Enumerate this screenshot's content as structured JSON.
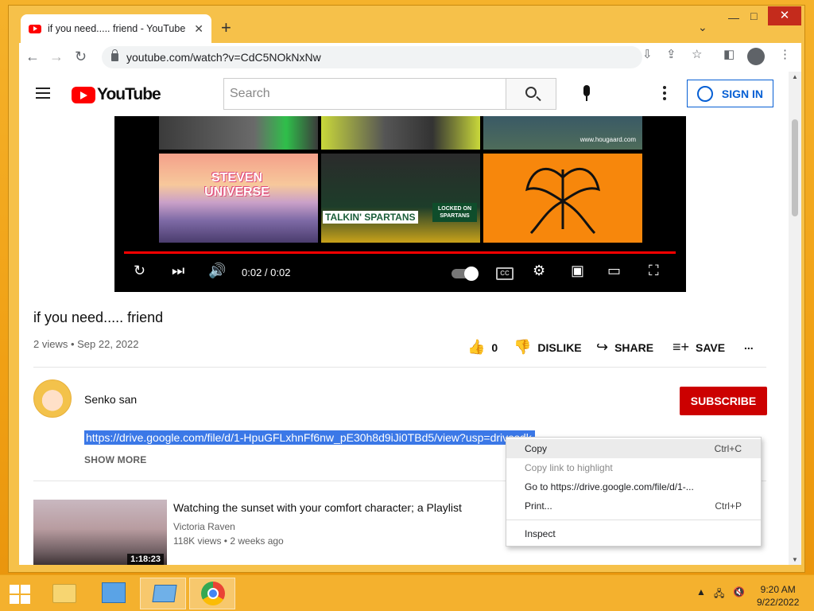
{
  "browser": {
    "tab_title": "if you need..... friend - YouTube",
    "tab_close": "✕",
    "new_tab": "+",
    "url": "youtube.com/watch?v=CdC5NOkNxNw",
    "window_controls": {
      "minimize": "—",
      "maximize": "□",
      "close": "✕"
    }
  },
  "youtube": {
    "logo_text": "YouTube",
    "search_placeholder": "Search",
    "sign_in": "SIGN IN"
  },
  "player": {
    "time": "0:02 / 0:02",
    "progress_fraction": 1.0,
    "thumbnails": [
      {
        "name": "steven-universe",
        "text": "STEVEN UNIVERSE"
      },
      {
        "name": "talkin-spartans",
        "text": "TALKIN' SPARTANS"
      },
      {
        "name": "locked-on-spartans",
        "text": "LOCKED ON SPARTANS"
      },
      {
        "name": "scenic",
        "text": "www.hougaard.com"
      },
      {
        "name": "orange-art",
        "text": ""
      }
    ]
  },
  "video": {
    "title": "if you need..... friend",
    "meta": "2 views • Sep 22, 2022",
    "likes": "0",
    "dislike": "DISLIKE",
    "share": "SHARE",
    "save": "SAVE",
    "more": "..."
  },
  "channel": {
    "name": "Senko san",
    "subscribe": "SUBSCRIBE",
    "description_link": "https://drive.google.com/file/d/1-HpuGFLxhnFf6nw_pE30h8d9iJi0TBd5/view?usp=drivesdk",
    "show_more": "SHOW MORE"
  },
  "recommendation": {
    "title": "Watching the sunset with your comfort character; a Playlist",
    "channel": "Victoria Raven",
    "meta": "118K views • 2 weeks ago",
    "duration": "1:18:23"
  },
  "context_menu": {
    "items": [
      {
        "label": "Copy",
        "shortcut": "Ctrl+C"
      },
      {
        "label": "Copy link to highlight",
        "shortcut": ""
      },
      {
        "label": "Go to https://drive.google.com/file/d/1-...",
        "shortcut": ""
      },
      {
        "label": "Print...",
        "shortcut": "Ctrl+P"
      },
      {
        "label": "Inspect",
        "shortcut": ""
      }
    ]
  },
  "taskbar": {
    "time": "9:20 AM",
    "date": "9/22/2022"
  },
  "colors": {
    "youtube_red": "#ff0000",
    "subscribe_red": "#cc0000",
    "link_blue": "#065fd4",
    "selection_blue": "#3b78e7",
    "desktop_orange": "#f3a418"
  }
}
